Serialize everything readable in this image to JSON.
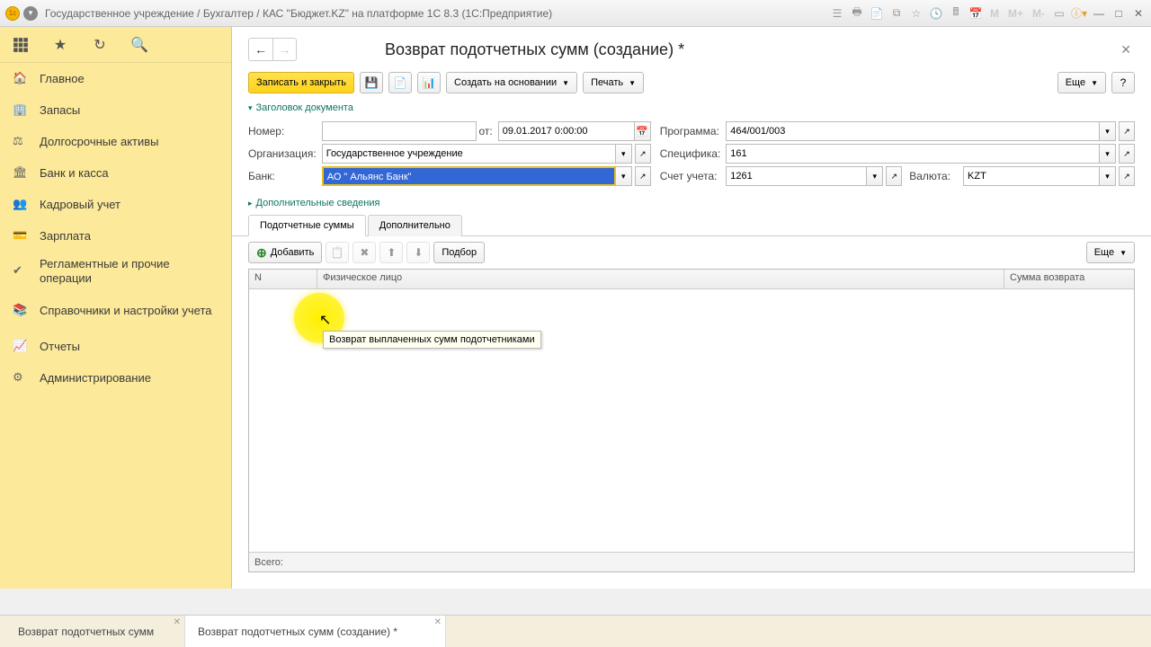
{
  "titlebar": {
    "text": "Государственное учреждение / Бухгалтер / КАС \"Бюджет.KZ\" на платформе 1С 8.3  (1С:Предприятие)",
    "m_buttons": [
      "M",
      "M+",
      "M-"
    ]
  },
  "sidebar": {
    "items": [
      {
        "label": "Главное"
      },
      {
        "label": "Запасы"
      },
      {
        "label": "Долгосрочные активы"
      },
      {
        "label": "Банк и касса"
      },
      {
        "label": "Кадровый учет"
      },
      {
        "label": "Зарплата"
      },
      {
        "label": "Регламентные и прочие операции"
      },
      {
        "label": "Справочники и настройки учета"
      },
      {
        "label": "Отчеты"
      },
      {
        "label": "Администрирование"
      }
    ]
  },
  "page": {
    "title": "Возврат подотчетных сумм (создание) *"
  },
  "toolbar": {
    "save_close": "Записать и закрыть",
    "create_based": "Создать на основании",
    "print": "Печать",
    "more": "Еще"
  },
  "sections": {
    "header": "Заголовок документа",
    "additional": "Дополнительные сведения"
  },
  "form": {
    "number_label": "Номер:",
    "number_value": "",
    "date_label": "от:",
    "date_value": "09.01.2017 0:00:00",
    "program_label": "Программа:",
    "program_value": "464/001/003",
    "org_label": "Организация:",
    "org_value": "Государственное учреждение",
    "spec_label": "Специфика:",
    "spec_value": "161",
    "bank_label": "Банк:",
    "bank_value": "АО \" Альянс Банк\"",
    "account_label": "Счет учета:",
    "account_value": "1261",
    "currency_label": "Валюта:",
    "currency_value": "KZT"
  },
  "tabs": {
    "tab1": "Подотчетные суммы",
    "tab2": "Дополнительно"
  },
  "table_toolbar": {
    "add": "Добавить",
    "pick": "Подбор",
    "more": "Еще"
  },
  "table": {
    "col_n": "N",
    "col_person": "Физическое лицо",
    "col_sum": "Сумма возврата",
    "footer_total": "Всего:"
  },
  "tooltip": "Возврат выплаченных сумм подотчетниками",
  "bottom_tabs": {
    "tab1": "Возврат подотчетных сумм",
    "tab2": "Возврат подотчетных сумм (создание) *"
  }
}
